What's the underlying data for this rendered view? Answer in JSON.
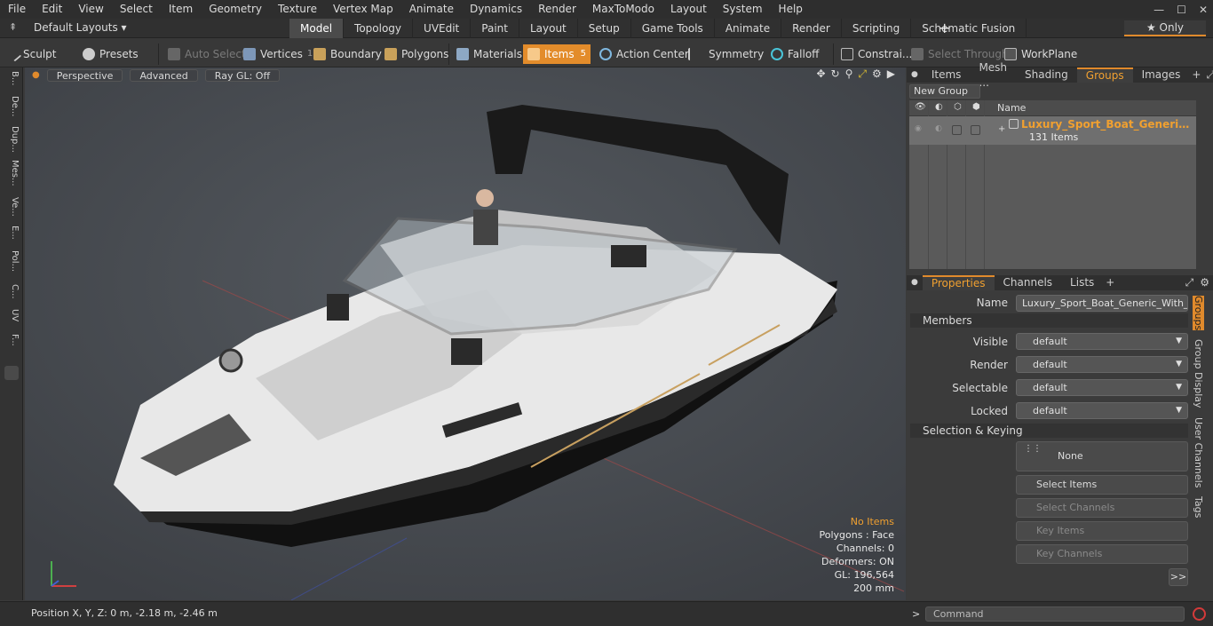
{
  "menubar": {
    "items": [
      "File",
      "Edit",
      "View",
      "Select",
      "Item",
      "Geometry",
      "Texture",
      "Vertex Map",
      "Animate",
      "Dynamics",
      "Render",
      "MaxToModo",
      "Layout",
      "System",
      "Help"
    ]
  },
  "layoutbar": {
    "default_layouts": "Default Layouts ▾",
    "tabs": [
      "Model",
      "Topology",
      "UVEdit",
      "Paint",
      "Layout",
      "Setup",
      "Game Tools",
      "Animate",
      "Render",
      "Scripting",
      "Schematic Fusion"
    ],
    "active_tab": "Model",
    "only_label": "★ Only"
  },
  "toolbar": {
    "sculpt": "Sculpt",
    "presets": "Presets",
    "auto_select": "Auto Select",
    "vertices": "Vertices",
    "vertices_count": "1",
    "boundary": "Boundary",
    "polygons": "Polygons",
    "materials": "Materials",
    "items": "Items",
    "items_count": "5",
    "action_center": "Action Center",
    "symmetry": "Symmetry",
    "falloff": "Falloff",
    "constraints": "Constrai...",
    "select_through": "Select Through",
    "workplane": "WorkPlane"
  },
  "leftstrip": {
    "tabs": [
      "B...",
      "De...",
      "Dup...",
      "Mes...",
      "Ve...",
      "E...",
      "Pol...",
      "C...",
      "UV",
      "F..."
    ]
  },
  "viewport": {
    "perspective": "Perspective",
    "advanced": "Advanced",
    "raygl": "Ray GL: Off",
    "hud": {
      "no_items": "No Items",
      "polygons": "Polygons : Face",
      "channels": "Channels: 0",
      "deformers": "Deformers: ON",
      "gl": "GL: 196,564",
      "scale": "200 mm"
    }
  },
  "status": {
    "position": "Position X, Y, Z:   0 m, -2.18 m, -2.46 m",
    "command_placeholder": "Command"
  },
  "groups_panel": {
    "tabs": [
      "Items",
      "Mesh ...",
      "Shading",
      "Groups",
      "Images"
    ],
    "active_tab": "Groups",
    "new_group": "New Group",
    "name_header": "Name",
    "group_name": "Luxury_Sport_Boat_Generic_Wi...",
    "group_count": "131 Items"
  },
  "properties": {
    "tabs": [
      "Properties",
      "Channels",
      "Lists"
    ],
    "active_tab": "Properties",
    "name_label": "Name",
    "name_value": "Luxury_Sport_Boat_Generic_With_Dri",
    "members_section": "Members",
    "visible_label": "Visible",
    "visible_value": "default",
    "render_label": "Render",
    "render_value": "default",
    "selectable_label": "Selectable",
    "selectable_value": "default",
    "locked_label": "Locked",
    "locked_value": "default",
    "selection_section": "Selection & Keying",
    "none_btn": "None",
    "select_items": "Select Items",
    "select_channels": "Select Channels",
    "key_items": "Key Items",
    "key_channels": "Key Channels",
    "more": ">>"
  },
  "side_vtabs": [
    "Groups",
    "Group Display",
    "User Channels",
    "Tags"
  ]
}
